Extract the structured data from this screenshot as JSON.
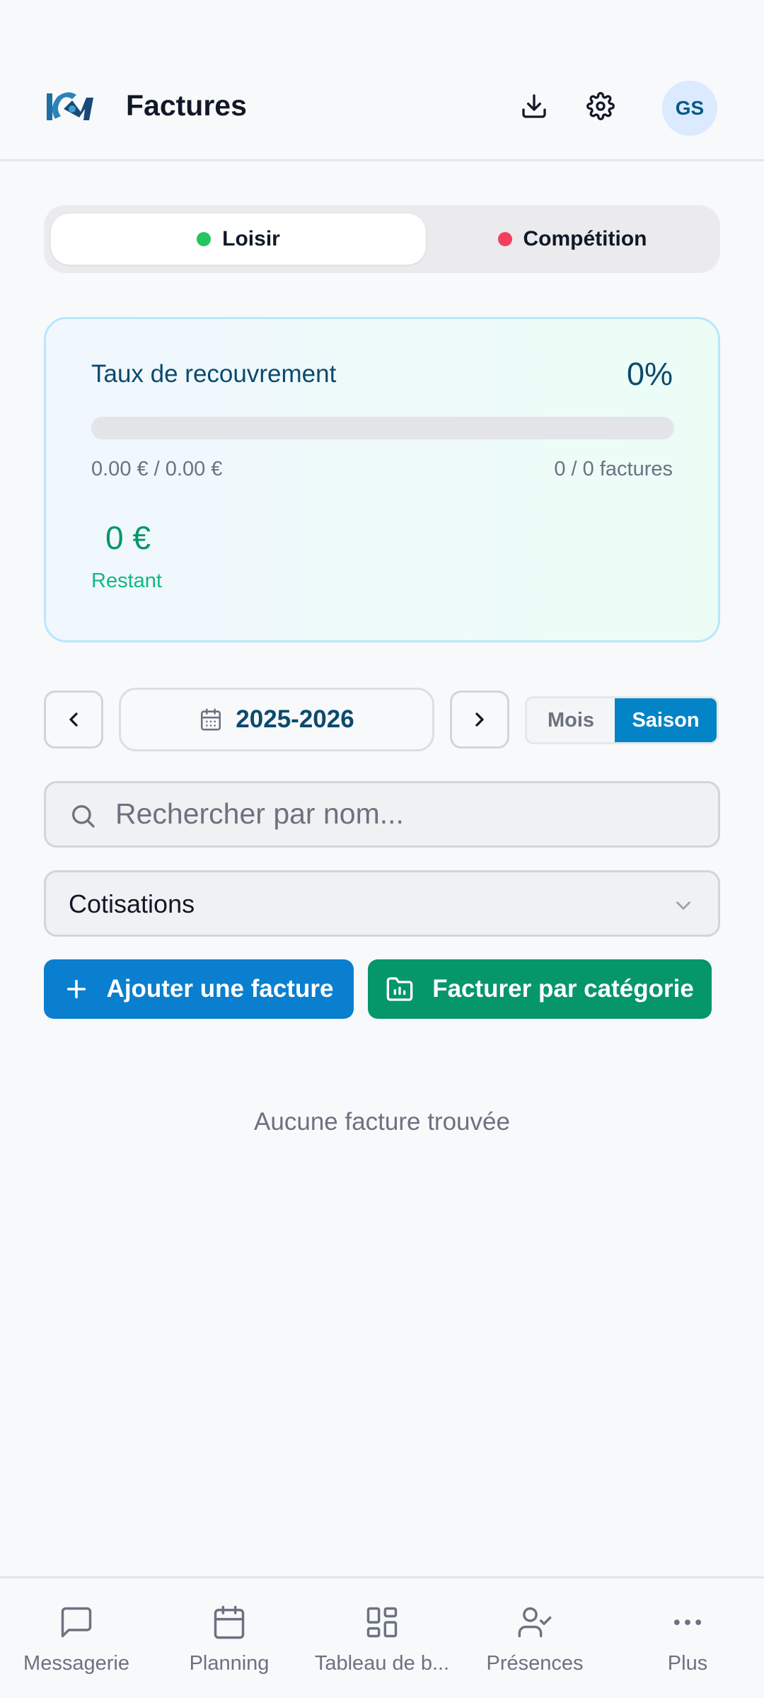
{
  "header": {
    "title": "Factures",
    "avatar_initials": "GS",
    "icons": [
      "download-icon",
      "gear-icon"
    ]
  },
  "segment": {
    "loisir": "Loisir",
    "competition": "Compétition",
    "active": "Loisir",
    "loisir_color": "#22c55e",
    "competition_color": "#f43f5e"
  },
  "recovery": {
    "title": "Taux de recouvrement",
    "percent": "0%",
    "progress": 0,
    "amounts": "0.00 € / 0.00 €",
    "invoices": "0 / 0 factures",
    "remaining_value": "0 €",
    "remaining_label": "Restant"
  },
  "period": {
    "season": "2025-2026",
    "mode_month": "Mois",
    "mode_season": "Saison",
    "active_mode": "Saison"
  },
  "search": {
    "placeholder": "Rechercher par nom..."
  },
  "filter": {
    "selected": "Cotisations"
  },
  "actions": {
    "add_invoice": "Ajouter une facture",
    "invoice_by_category": "Facturer par catégorie"
  },
  "empty_state": "Aucune facture trouvée",
  "tabbar": {
    "items": [
      {
        "label": "Messagerie",
        "icon": "message-icon"
      },
      {
        "label": "Planning",
        "icon": "calendar-icon"
      },
      {
        "label": "Tableau de b...",
        "icon": "dashboard-icon"
      },
      {
        "label": "Présences",
        "icon": "user-check-icon"
      },
      {
        "label": "Plus",
        "icon": "more-icon"
      }
    ]
  },
  "colors": {
    "primary": "#0284c7",
    "success": "#059669",
    "background": "#f8f9fb"
  }
}
